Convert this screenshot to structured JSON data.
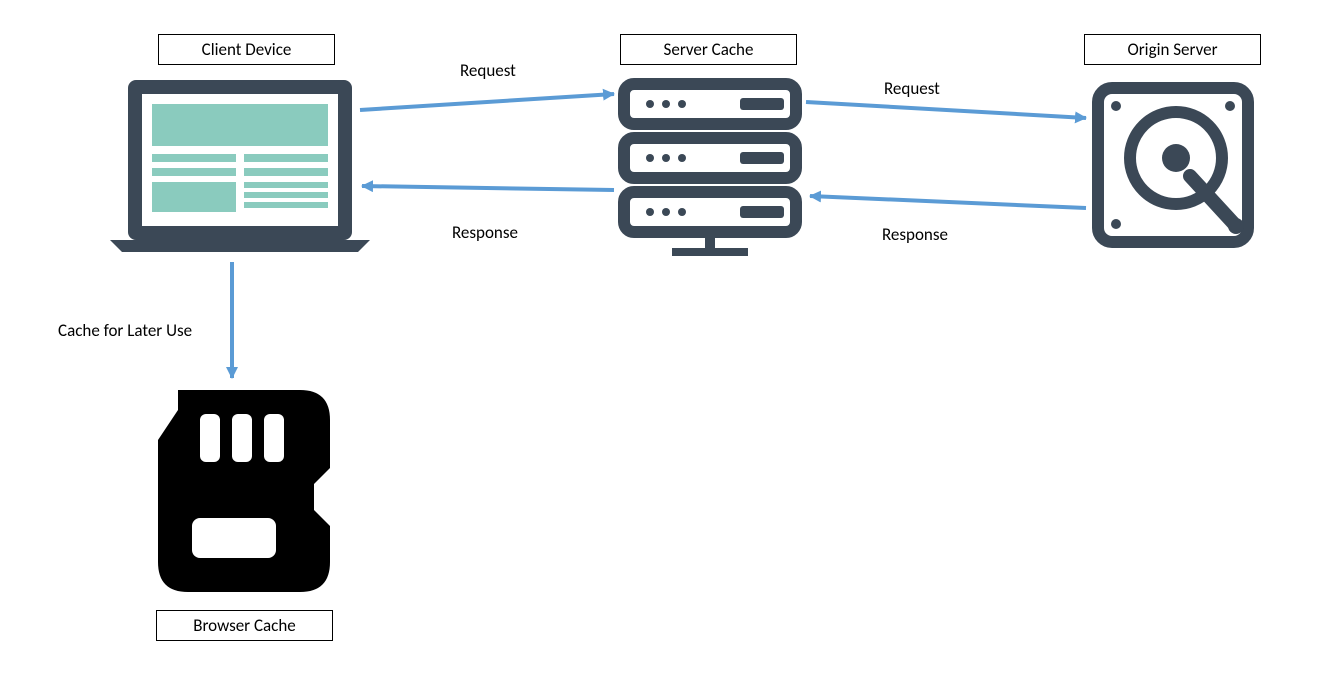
{
  "nodes": {
    "client": {
      "label": "Client Device"
    },
    "serverCache": {
      "label": "Server Cache"
    },
    "origin": {
      "label": "Origin Server"
    },
    "browserCache": {
      "label": "Browser Cache"
    }
  },
  "edges": {
    "client_to_server": {
      "label": "Request"
    },
    "server_to_origin": {
      "label": "Request"
    },
    "origin_to_server": {
      "label": "Response"
    },
    "server_to_client": {
      "label": "Response"
    },
    "client_to_browser": {
      "label": "Cache for Later Use"
    }
  },
  "colors": {
    "arrow": "#5B9BD5",
    "iconDark": "#3B4856",
    "iconTeal": "#8ACBBE",
    "iconBlack": "#000000"
  }
}
